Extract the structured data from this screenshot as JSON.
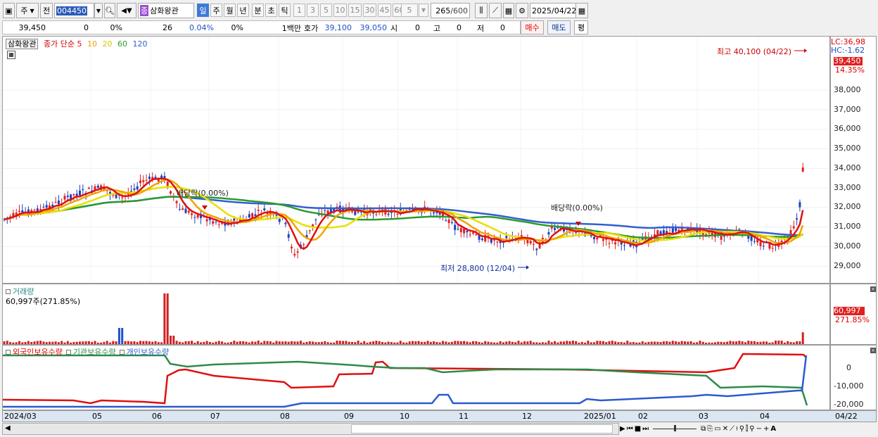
{
  "toolbar": {
    "mode_label": "주",
    "prev_label": "전",
    "code": "004450",
    "stock_badge": "종",
    "stock_name": "삼화왕관",
    "periods": [
      "일",
      "주",
      "월",
      "년",
      "분",
      "초",
      "틱"
    ],
    "minutes": [
      "1",
      "3",
      "5",
      "10",
      "15",
      "30",
      "45",
      "60"
    ],
    "unit": "5",
    "count": "265",
    "count_max": "/600",
    "date": "2025/04/22"
  },
  "inforow": {
    "price": "39,450",
    "change": "0",
    "change_pct": "0%",
    "volume": "26",
    "vol_pct": "0.04%",
    "ratio": "0%",
    "unit": "1백만",
    "hoga_label": "호가",
    "ask": "39,100",
    "bid": "39,050",
    "si_label": "시",
    "si_value": "0",
    "go_label": "고",
    "go_value": "0",
    "jeo_label": "저",
    "jeo_value": "0",
    "buy_label": "매수",
    "sell_label": "매도",
    "flat_label": "평"
  },
  "price_pane": {
    "legend_name": "삼화왕관",
    "legend_title": "종가 단순",
    "ma": [
      {
        "label": "5",
        "color": "#dd1111"
      },
      {
        "label": "10",
        "color": "#f0a400"
      },
      {
        "label": "20",
        "color": "#e8e000"
      },
      {
        "label": "60",
        "color": "#2e9a2e"
      },
      {
        "label": "120",
        "color": "#3060d0"
      }
    ],
    "high_label": "최고 40,100 (04/22)",
    "low_label": "최저 28,800 (12/04)",
    "dividend_1": "배당락(0.00%)",
    "dividend_2": "배당락(0.00%)",
    "lc": "LC:36,98",
    "hc": "HC:-1.62",
    "last": "39,450",
    "pct": "14.35%",
    "y_ticks": [
      "38,000",
      "37,000",
      "36,000",
      "35,000",
      "34,000",
      "33,000",
      "32,000",
      "31,000",
      "30,000",
      "29,000"
    ]
  },
  "volume_pane": {
    "title": "거래량",
    "value": "60,997주(271.85%)",
    "last": "60,997",
    "pct": "271.85%"
  },
  "holdings_pane": {
    "legend": [
      "외국인보유수량",
      "기관보유수량",
      "개인보유수량"
    ],
    "y_ticks": [
      "0",
      "-10,000",
      "-20,000"
    ]
  },
  "x_axis": [
    "2024/03",
    "05",
    "06",
    "07",
    "08",
    "09",
    "10",
    "11",
    "12",
    "2025/01",
    "02",
    "03",
    "04",
    "04/22"
  ]
}
